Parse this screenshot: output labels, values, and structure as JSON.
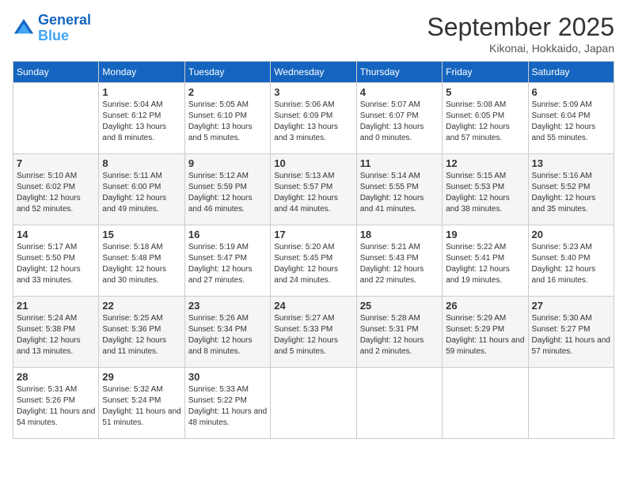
{
  "header": {
    "logo_line1": "General",
    "logo_line2": "Blue",
    "month": "September 2025",
    "location": "Kikonai, Hokkaido, Japan"
  },
  "weekdays": [
    "Sunday",
    "Monday",
    "Tuesday",
    "Wednesday",
    "Thursday",
    "Friday",
    "Saturday"
  ],
  "weeks": [
    [
      {
        "day": "",
        "sunrise": "",
        "sunset": "",
        "daylight": ""
      },
      {
        "day": "1",
        "sunrise": "Sunrise: 5:04 AM",
        "sunset": "Sunset: 6:12 PM",
        "daylight": "Daylight: 13 hours and 8 minutes."
      },
      {
        "day": "2",
        "sunrise": "Sunrise: 5:05 AM",
        "sunset": "Sunset: 6:10 PM",
        "daylight": "Daylight: 13 hours and 5 minutes."
      },
      {
        "day": "3",
        "sunrise": "Sunrise: 5:06 AM",
        "sunset": "Sunset: 6:09 PM",
        "daylight": "Daylight: 13 hours and 3 minutes."
      },
      {
        "day": "4",
        "sunrise": "Sunrise: 5:07 AM",
        "sunset": "Sunset: 6:07 PM",
        "daylight": "Daylight: 13 hours and 0 minutes."
      },
      {
        "day": "5",
        "sunrise": "Sunrise: 5:08 AM",
        "sunset": "Sunset: 6:05 PM",
        "daylight": "Daylight: 12 hours and 57 minutes."
      },
      {
        "day": "6",
        "sunrise": "Sunrise: 5:09 AM",
        "sunset": "Sunset: 6:04 PM",
        "daylight": "Daylight: 12 hours and 55 minutes."
      }
    ],
    [
      {
        "day": "7",
        "sunrise": "Sunrise: 5:10 AM",
        "sunset": "Sunset: 6:02 PM",
        "daylight": "Daylight: 12 hours and 52 minutes."
      },
      {
        "day": "8",
        "sunrise": "Sunrise: 5:11 AM",
        "sunset": "Sunset: 6:00 PM",
        "daylight": "Daylight: 12 hours and 49 minutes."
      },
      {
        "day": "9",
        "sunrise": "Sunrise: 5:12 AM",
        "sunset": "Sunset: 5:59 PM",
        "daylight": "Daylight: 12 hours and 46 minutes."
      },
      {
        "day": "10",
        "sunrise": "Sunrise: 5:13 AM",
        "sunset": "Sunset: 5:57 PM",
        "daylight": "Daylight: 12 hours and 44 minutes."
      },
      {
        "day": "11",
        "sunrise": "Sunrise: 5:14 AM",
        "sunset": "Sunset: 5:55 PM",
        "daylight": "Daylight: 12 hours and 41 minutes."
      },
      {
        "day": "12",
        "sunrise": "Sunrise: 5:15 AM",
        "sunset": "Sunset: 5:53 PM",
        "daylight": "Daylight: 12 hours and 38 minutes."
      },
      {
        "day": "13",
        "sunrise": "Sunrise: 5:16 AM",
        "sunset": "Sunset: 5:52 PM",
        "daylight": "Daylight: 12 hours and 35 minutes."
      }
    ],
    [
      {
        "day": "14",
        "sunrise": "Sunrise: 5:17 AM",
        "sunset": "Sunset: 5:50 PM",
        "daylight": "Daylight: 12 hours and 33 minutes."
      },
      {
        "day": "15",
        "sunrise": "Sunrise: 5:18 AM",
        "sunset": "Sunset: 5:48 PM",
        "daylight": "Daylight: 12 hours and 30 minutes."
      },
      {
        "day": "16",
        "sunrise": "Sunrise: 5:19 AM",
        "sunset": "Sunset: 5:47 PM",
        "daylight": "Daylight: 12 hours and 27 minutes."
      },
      {
        "day": "17",
        "sunrise": "Sunrise: 5:20 AM",
        "sunset": "Sunset: 5:45 PM",
        "daylight": "Daylight: 12 hours and 24 minutes."
      },
      {
        "day": "18",
        "sunrise": "Sunrise: 5:21 AM",
        "sunset": "Sunset: 5:43 PM",
        "daylight": "Daylight: 12 hours and 22 minutes."
      },
      {
        "day": "19",
        "sunrise": "Sunrise: 5:22 AM",
        "sunset": "Sunset: 5:41 PM",
        "daylight": "Daylight: 12 hours and 19 minutes."
      },
      {
        "day": "20",
        "sunrise": "Sunrise: 5:23 AM",
        "sunset": "Sunset: 5:40 PM",
        "daylight": "Daylight: 12 hours and 16 minutes."
      }
    ],
    [
      {
        "day": "21",
        "sunrise": "Sunrise: 5:24 AM",
        "sunset": "Sunset: 5:38 PM",
        "daylight": "Daylight: 12 hours and 13 minutes."
      },
      {
        "day": "22",
        "sunrise": "Sunrise: 5:25 AM",
        "sunset": "Sunset: 5:36 PM",
        "daylight": "Daylight: 12 hours and 11 minutes."
      },
      {
        "day": "23",
        "sunrise": "Sunrise: 5:26 AM",
        "sunset": "Sunset: 5:34 PM",
        "daylight": "Daylight: 12 hours and 8 minutes."
      },
      {
        "day": "24",
        "sunrise": "Sunrise: 5:27 AM",
        "sunset": "Sunset: 5:33 PM",
        "daylight": "Daylight: 12 hours and 5 minutes."
      },
      {
        "day": "25",
        "sunrise": "Sunrise: 5:28 AM",
        "sunset": "Sunset: 5:31 PM",
        "daylight": "Daylight: 12 hours and 2 minutes."
      },
      {
        "day": "26",
        "sunrise": "Sunrise: 5:29 AM",
        "sunset": "Sunset: 5:29 PM",
        "daylight": "Daylight: 11 hours and 59 minutes."
      },
      {
        "day": "27",
        "sunrise": "Sunrise: 5:30 AM",
        "sunset": "Sunset: 5:27 PM",
        "daylight": "Daylight: 11 hours and 57 minutes."
      }
    ],
    [
      {
        "day": "28",
        "sunrise": "Sunrise: 5:31 AM",
        "sunset": "Sunset: 5:26 PM",
        "daylight": "Daylight: 11 hours and 54 minutes."
      },
      {
        "day": "29",
        "sunrise": "Sunrise: 5:32 AM",
        "sunset": "Sunset: 5:24 PM",
        "daylight": "Daylight: 11 hours and 51 minutes."
      },
      {
        "day": "30",
        "sunrise": "Sunrise: 5:33 AM",
        "sunset": "Sunset: 5:22 PM",
        "daylight": "Daylight: 11 hours and 48 minutes."
      },
      {
        "day": "",
        "sunrise": "",
        "sunset": "",
        "daylight": ""
      },
      {
        "day": "",
        "sunrise": "",
        "sunset": "",
        "daylight": ""
      },
      {
        "day": "",
        "sunrise": "",
        "sunset": "",
        "daylight": ""
      },
      {
        "day": "",
        "sunrise": "",
        "sunset": "",
        "daylight": ""
      }
    ]
  ]
}
